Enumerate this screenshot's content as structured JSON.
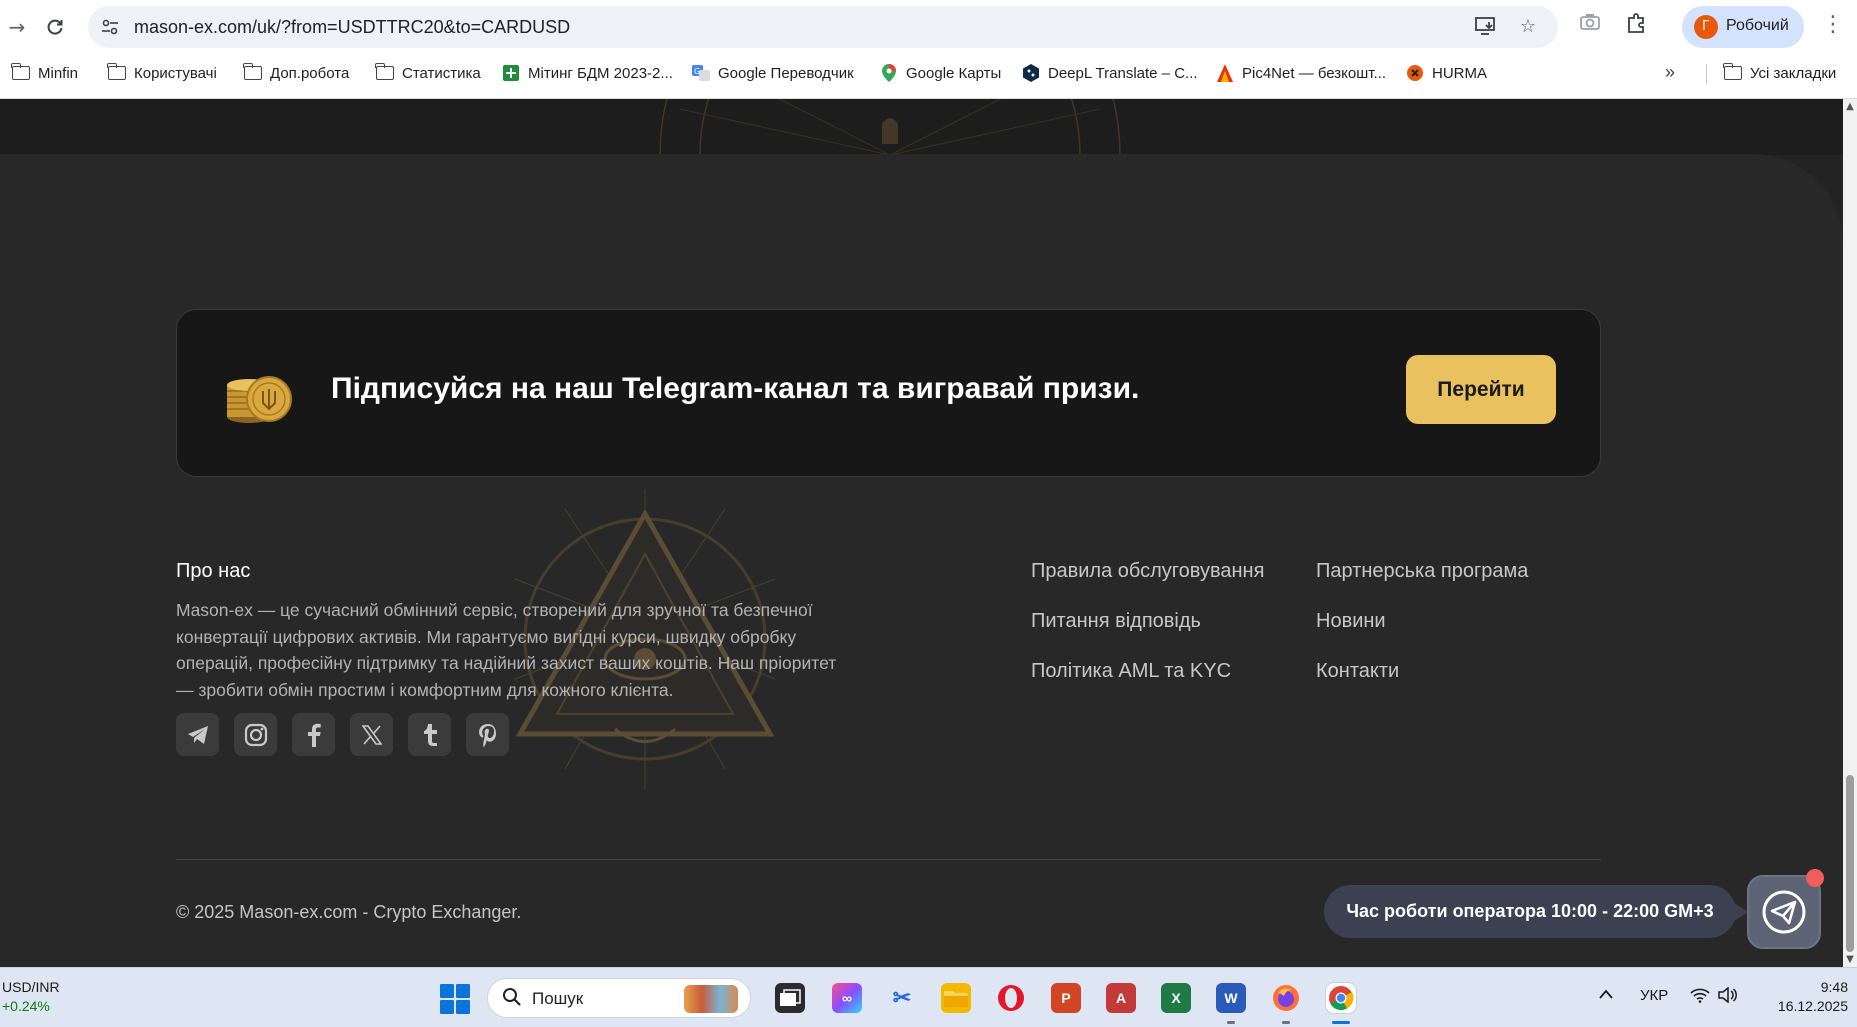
{
  "browser": {
    "url": "mason-ex.com/uk/?from=USDTTRC20&to=CARDUSD",
    "profile_initial": "Г",
    "profile_name": "Робочий",
    "bookmarks": [
      {
        "label": "Minfin",
        "icon": "folder-icon"
      },
      {
        "label": "Користувачі",
        "icon": "folder-icon"
      },
      {
        "label": "Доп.робота",
        "icon": "folder-icon"
      },
      {
        "label": "Статистика",
        "icon": "folder-icon"
      },
      {
        "label": "Мітинг БДМ 2023-2...",
        "icon": "sheets-icon"
      },
      {
        "label": "Google Переводчик",
        "icon": "translate-icon"
      },
      {
        "label": "Google Карты",
        "icon": "maps-pin-icon"
      },
      {
        "label": "DeepL Translate – С...",
        "icon": "deepl-icon"
      },
      {
        "label": "Pic4Net — безкошт...",
        "icon": "pic4net-icon"
      },
      {
        "label": "HURMA",
        "icon": "hurma-icon"
      }
    ],
    "all_bookmarks_label": "Усі закладки"
  },
  "banner": {
    "text": "Підписуйся на наш Telegram-канал та вигравай призи.",
    "button_label": "Перейти"
  },
  "about": {
    "title": "Про нас",
    "text": "Mason-ex — це сучасний обмінний сервіс, створений для зручної та безпечної конвертації цифрових активів. Ми гарантуємо вигідні курси, швидку обробку операцій, професійну підтримку та надійний захист ваших коштів. Наш пріоритет — зробити обмін простим і комфортним для кожного клієнта."
  },
  "links": {
    "col1": [
      "Правила обслуговування",
      "Питання відповідь",
      "Політика AML та KYC"
    ],
    "col2": [
      "Партнерська програма",
      "Новини",
      "Контакти"
    ]
  },
  "socials": [
    "telegram-icon",
    "instagram-icon",
    "facebook-icon",
    "x-icon",
    "tumblr-icon",
    "pinterest-icon"
  ],
  "footer": {
    "copyright": "© 2025 Mason-ex.com - Crypto Exchanger.",
    "operator_hours": "Час роботи оператора 10:00 - 22:00 GM+3"
  },
  "taskbar": {
    "ticker_pair": "USD/INR",
    "ticker_change": "+0.24%",
    "search_placeholder": "Пошук",
    "language": "УКР",
    "time": "9:48",
    "date": "16.12.2025"
  },
  "colors": {
    "accent_button": "#e9c15e",
    "page_bg": "#282828",
    "banner_bg": "#171717",
    "operator_bubble": "#3b4150"
  }
}
